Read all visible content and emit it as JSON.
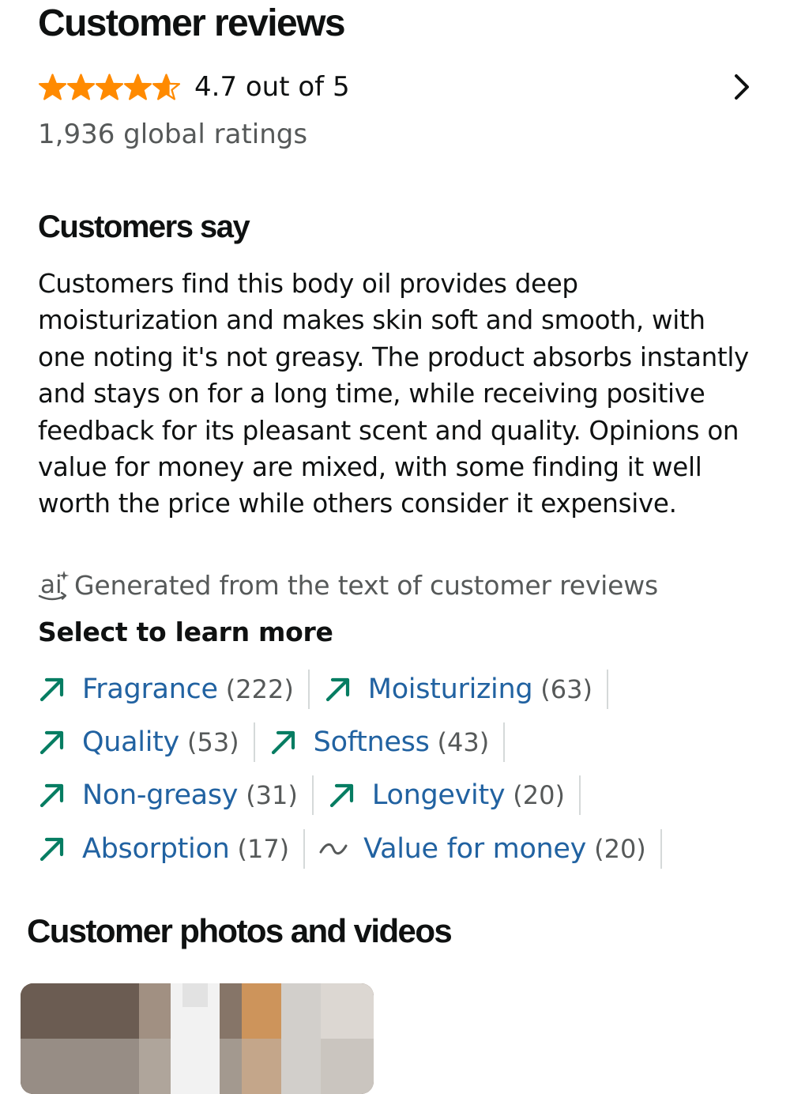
{
  "header": {
    "title": "Customer reviews"
  },
  "rating": {
    "stars": 4.7,
    "text": "4.7 out of 5",
    "global_ratings": "1,936 global ratings",
    "star_color": "#ff8a00",
    "icons": [
      "star-icon",
      "chevron-right-icon"
    ]
  },
  "customers_say": {
    "title": "Customers say",
    "summary": "Customers find this body oil provides deep moisturization and makes skin soft and smooth, with one noting it's not greasy. The product absorbs instantly and stays on for a long time, while receiving positive feedback for its pleasant scent and quality. Opinions on value for money are mixed, with some finding it well worth the price while others consider it expensive.",
    "ai_note": "Generated from the text of customer reviews",
    "ai_icon": "ai-icon"
  },
  "learn_more": {
    "title": "Select to learn more",
    "colors": {
      "link": "#2162a1",
      "positive": "#067d62",
      "mixed": "#565959",
      "count": "#565959"
    },
    "rows": [
      [
        {
          "label": "Fragrance",
          "count": "(222)",
          "trend": "positive"
        },
        {
          "label": "Moisturizing",
          "count": "(63)",
          "trend": "positive"
        }
      ],
      [
        {
          "label": "Quality",
          "count": "(53)",
          "trend": "positive"
        },
        {
          "label": "Softness",
          "count": "(43)",
          "trend": "positive"
        }
      ],
      [
        {
          "label": "Non-greasy",
          "count": "(31)",
          "trend": "positive"
        },
        {
          "label": "Longevity",
          "count": "(20)",
          "trend": "positive"
        }
      ],
      [
        {
          "label": "Absorption",
          "count": "(17)",
          "trend": "positive"
        },
        {
          "label": "Value for money",
          "count": "(20)",
          "trend": "mixed"
        }
      ]
    ]
  },
  "photos": {
    "title": "Customer photos and videos"
  }
}
